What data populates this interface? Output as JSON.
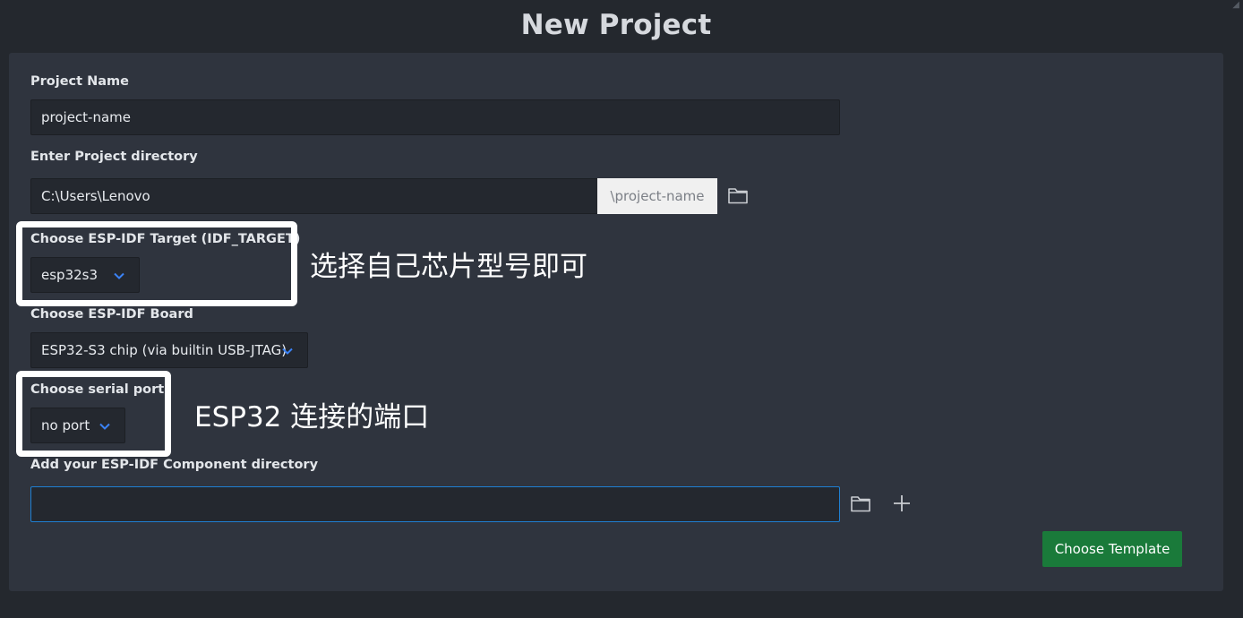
{
  "page": {
    "title": "New Project"
  },
  "form": {
    "project_name": {
      "label": "Project Name",
      "value": "project-name"
    },
    "project_dir": {
      "label": "Enter Project directory",
      "value": "C:\\Users\\Lenovo",
      "suffix": "\\project-name"
    },
    "target": {
      "label": "Choose ESP-IDF Target (IDF_TARGET)",
      "value": "esp32s3"
    },
    "board": {
      "label": "Choose ESP-IDF Board",
      "value": "ESP32-S3 chip (via builtin USB-JTAG)"
    },
    "serial_port": {
      "label": "Choose serial port",
      "value": "no port"
    },
    "component_dir": {
      "label": "Add your ESP-IDF Component directory",
      "value": ""
    }
  },
  "annotations": {
    "target_note": "选择自己芯片型号即可",
    "port_note": "ESP32 连接的端口"
  },
  "actions": {
    "choose_template": "Choose Template"
  },
  "icons": {
    "folder": "folder-icon",
    "plus": "plus-icon",
    "chevron": "chevron-down-icon"
  },
  "colors": {
    "accent": "#1f7fd1",
    "chevron": "#3b82f6",
    "button_green": "#1a7a3a"
  }
}
